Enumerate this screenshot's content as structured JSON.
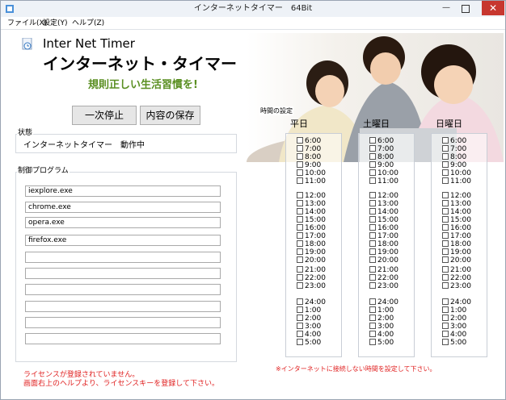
{
  "window": {
    "title": "インターネットタイマー　64Bit",
    "min_label": "—",
    "close_label": "✕"
  },
  "menu": [
    {
      "label": "ファイル(X)"
    },
    {
      "label": "設定(Y)"
    },
    {
      "label": "ヘルプ(Z)"
    }
  ],
  "header": {
    "app_name": "Inter Net Timer",
    "app_name_jp": "インターネット・タイマー",
    "slogan": "規則正しい生活習慣を!"
  },
  "toolbar": {
    "pause_label": "一次停止",
    "save_label": "内容の保存"
  },
  "status": {
    "label": "状態",
    "text": "インターネットタイマー　動作中"
  },
  "programs": {
    "label": "制御プログラム",
    "items": [
      "iexplore.exe",
      "chrome.exe",
      "opera.exe",
      "firefox.exe",
      "",
      "",
      "",
      "",
      "",
      ""
    ]
  },
  "license": {
    "line1": "ライセンスが登録されていません。",
    "line2": "画面右上のヘルプより、ライセンスキーを登録して下さい。"
  },
  "schedule": {
    "label": "時間の設定",
    "columns": [
      {
        "title": "平日"
      },
      {
        "title": "土曜日"
      },
      {
        "title": "日曜日"
      }
    ],
    "hours": [
      "6:00",
      "7:00",
      "8:00",
      "9:00",
      "10:00",
      "11:00",
      "12:00",
      "13:00",
      "14:00",
      "15:00",
      "16:00",
      "17:00",
      "18:00",
      "19:00",
      "20:00",
      "21:00",
      "22:00",
      "23:00",
      "24:00",
      "1:00",
      "2:00",
      "3:00",
      "4:00",
      "5:00"
    ],
    "note": "※インターネットに接続しない時間を設定して下さい。"
  },
  "colors": {
    "accent_green": "#5a8f22",
    "warning_red": "#e02020",
    "close_red": "#c7372f"
  }
}
